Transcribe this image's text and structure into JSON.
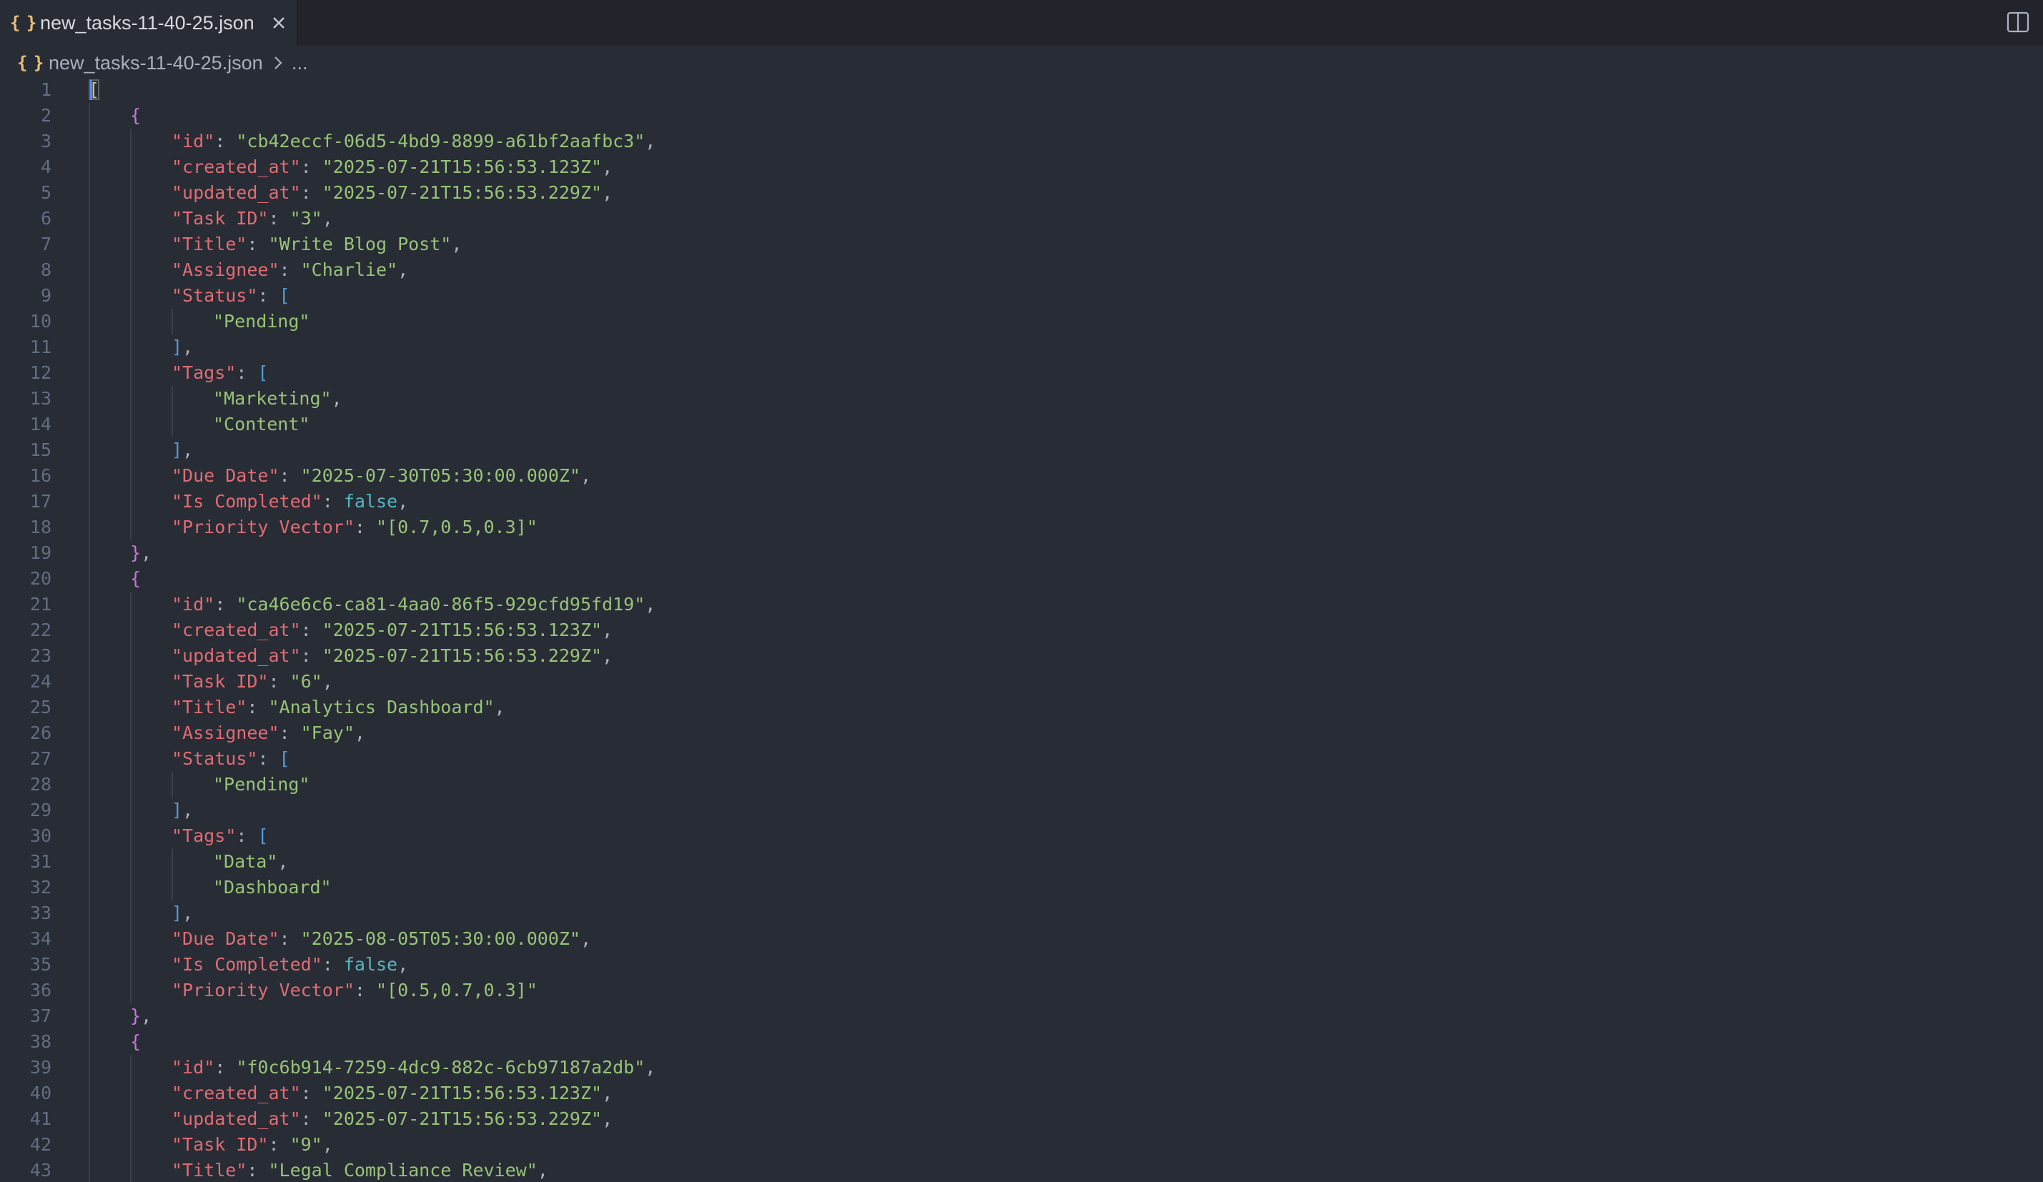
{
  "tab": {
    "label": "new_tasks-11-40-25.json",
    "icon": "json-file-icon",
    "icon_glyph": "{ }"
  },
  "breadcrumb": {
    "file": "new_tasks-11-40-25.json",
    "more": "..."
  },
  "colors": {
    "background": "#282c34",
    "tabbar": "#21252b",
    "key": "#e06c75",
    "string": "#98c379",
    "boolean": "#56b6c2",
    "bracket_array": "#569cd6",
    "bracket_object": "#c678dd",
    "root_bracket": "#e5c07b",
    "line_number": "#636d83"
  },
  "lines": [
    {
      "n": "1",
      "indent": 0,
      "parts": [
        [
          "[",
          "root"
        ]
      ]
    },
    {
      "n": "2",
      "indent": 1,
      "parts": [
        [
          "{",
          "obj"
        ]
      ]
    },
    {
      "n": "3",
      "indent": 2,
      "parts": [
        [
          "\"id\"",
          "k"
        ],
        [
          ": ",
          "p"
        ],
        [
          "\"cb42eccf-06d5-4bd9-8899-a61bf2aafbc3\"",
          "s"
        ],
        [
          ",",
          "p"
        ]
      ]
    },
    {
      "n": "4",
      "indent": 2,
      "parts": [
        [
          "\"created_at\"",
          "k"
        ],
        [
          ": ",
          "p"
        ],
        [
          "\"2025-07-21T15:56:53.123Z\"",
          "s"
        ],
        [
          ",",
          "p"
        ]
      ]
    },
    {
      "n": "5",
      "indent": 2,
      "parts": [
        [
          "\"updated_at\"",
          "k"
        ],
        [
          ": ",
          "p"
        ],
        [
          "\"2025-07-21T15:56:53.229Z\"",
          "s"
        ],
        [
          ",",
          "p"
        ]
      ]
    },
    {
      "n": "6",
      "indent": 2,
      "parts": [
        [
          "\"Task ID\"",
          "k"
        ],
        [
          ": ",
          "p"
        ],
        [
          "\"3\"",
          "s"
        ],
        [
          ",",
          "p"
        ]
      ]
    },
    {
      "n": "7",
      "indent": 2,
      "parts": [
        [
          "\"Title\"",
          "k"
        ],
        [
          ": ",
          "p"
        ],
        [
          "\"Write Blog Post\"",
          "s"
        ],
        [
          ",",
          "p"
        ]
      ]
    },
    {
      "n": "8",
      "indent": 2,
      "parts": [
        [
          "\"Assignee\"",
          "k"
        ],
        [
          ": ",
          "p"
        ],
        [
          "\"Charlie\"",
          "s"
        ],
        [
          ",",
          "p"
        ]
      ]
    },
    {
      "n": "9",
      "indent": 2,
      "parts": [
        [
          "\"Status\"",
          "k"
        ],
        [
          ": ",
          "p"
        ],
        [
          "[",
          "b"
        ]
      ]
    },
    {
      "n": "10",
      "indent": 3,
      "parts": [
        [
          "\"Pending\"",
          "s"
        ]
      ]
    },
    {
      "n": "11",
      "indent": 2,
      "parts": [
        [
          "]",
          "b"
        ],
        [
          ",",
          "p"
        ]
      ]
    },
    {
      "n": "12",
      "indent": 2,
      "parts": [
        [
          "\"Tags\"",
          "k"
        ],
        [
          ": ",
          "p"
        ],
        [
          "[",
          "b"
        ]
      ]
    },
    {
      "n": "13",
      "indent": 3,
      "parts": [
        [
          "\"Marketing\"",
          "s"
        ],
        [
          ",",
          "p"
        ]
      ]
    },
    {
      "n": "14",
      "indent": 3,
      "parts": [
        [
          "\"Content\"",
          "s"
        ]
      ]
    },
    {
      "n": "15",
      "indent": 2,
      "parts": [
        [
          "]",
          "b"
        ],
        [
          ",",
          "p"
        ]
      ]
    },
    {
      "n": "16",
      "indent": 2,
      "parts": [
        [
          "\"Due Date\"",
          "k"
        ],
        [
          ": ",
          "p"
        ],
        [
          "\"2025-07-30T05:30:00.000Z\"",
          "s"
        ],
        [
          ",",
          "p"
        ]
      ]
    },
    {
      "n": "17",
      "indent": 2,
      "parts": [
        [
          "\"Is Completed\"",
          "k"
        ],
        [
          ": ",
          "p"
        ],
        [
          "false",
          "bool"
        ],
        [
          ",",
          "p"
        ]
      ]
    },
    {
      "n": "18",
      "indent": 2,
      "parts": [
        [
          "\"Priority Vector\"",
          "k"
        ],
        [
          ": ",
          "p"
        ],
        [
          "\"[0.7,0.5,0.3]\"",
          "s"
        ]
      ]
    },
    {
      "n": "19",
      "indent": 1,
      "parts": [
        [
          "}",
          "obj"
        ],
        [
          ",",
          "p"
        ]
      ]
    },
    {
      "n": "20",
      "indent": 1,
      "parts": [
        [
          "{",
          "obj"
        ]
      ]
    },
    {
      "n": "21",
      "indent": 2,
      "parts": [
        [
          "\"id\"",
          "k"
        ],
        [
          ": ",
          "p"
        ],
        [
          "\"ca46e6c6-ca81-4aa0-86f5-929cfd95fd19\"",
          "s"
        ],
        [
          ",",
          "p"
        ]
      ]
    },
    {
      "n": "22",
      "indent": 2,
      "parts": [
        [
          "\"created_at\"",
          "k"
        ],
        [
          ": ",
          "p"
        ],
        [
          "\"2025-07-21T15:56:53.123Z\"",
          "s"
        ],
        [
          ",",
          "p"
        ]
      ]
    },
    {
      "n": "23",
      "indent": 2,
      "parts": [
        [
          "\"updated_at\"",
          "k"
        ],
        [
          ": ",
          "p"
        ],
        [
          "\"2025-07-21T15:56:53.229Z\"",
          "s"
        ],
        [
          ",",
          "p"
        ]
      ]
    },
    {
      "n": "24",
      "indent": 2,
      "parts": [
        [
          "\"Task ID\"",
          "k"
        ],
        [
          ": ",
          "p"
        ],
        [
          "\"6\"",
          "s"
        ],
        [
          ",",
          "p"
        ]
      ]
    },
    {
      "n": "25",
      "indent": 2,
      "parts": [
        [
          "\"Title\"",
          "k"
        ],
        [
          ": ",
          "p"
        ],
        [
          "\"Analytics Dashboard\"",
          "s"
        ],
        [
          ",",
          "p"
        ]
      ]
    },
    {
      "n": "26",
      "indent": 2,
      "parts": [
        [
          "\"Assignee\"",
          "k"
        ],
        [
          ": ",
          "p"
        ],
        [
          "\"Fay\"",
          "s"
        ],
        [
          ",",
          "p"
        ]
      ]
    },
    {
      "n": "27",
      "indent": 2,
      "parts": [
        [
          "\"Status\"",
          "k"
        ],
        [
          ": ",
          "p"
        ],
        [
          "[",
          "b"
        ]
      ]
    },
    {
      "n": "28",
      "indent": 3,
      "parts": [
        [
          "\"Pending\"",
          "s"
        ]
      ]
    },
    {
      "n": "29",
      "indent": 2,
      "parts": [
        [
          "]",
          "b"
        ],
        [
          ",",
          "p"
        ]
      ]
    },
    {
      "n": "30",
      "indent": 2,
      "parts": [
        [
          "\"Tags\"",
          "k"
        ],
        [
          ": ",
          "p"
        ],
        [
          "[",
          "b"
        ]
      ]
    },
    {
      "n": "31",
      "indent": 3,
      "parts": [
        [
          "\"Data\"",
          "s"
        ],
        [
          ",",
          "p"
        ]
      ]
    },
    {
      "n": "32",
      "indent": 3,
      "parts": [
        [
          "\"Dashboard\"",
          "s"
        ]
      ]
    },
    {
      "n": "33",
      "indent": 2,
      "parts": [
        [
          "]",
          "b"
        ],
        [
          ",",
          "p"
        ]
      ]
    },
    {
      "n": "34",
      "indent": 2,
      "parts": [
        [
          "\"Due Date\"",
          "k"
        ],
        [
          ": ",
          "p"
        ],
        [
          "\"2025-08-05T05:30:00.000Z\"",
          "s"
        ],
        [
          ",",
          "p"
        ]
      ]
    },
    {
      "n": "35",
      "indent": 2,
      "parts": [
        [
          "\"Is Completed\"",
          "k"
        ],
        [
          ": ",
          "p"
        ],
        [
          "false",
          "bool"
        ],
        [
          ",",
          "p"
        ]
      ]
    },
    {
      "n": "36",
      "indent": 2,
      "parts": [
        [
          "\"Priority Vector\"",
          "k"
        ],
        [
          ": ",
          "p"
        ],
        [
          "\"[0.5,0.7,0.3]\"",
          "s"
        ]
      ]
    },
    {
      "n": "37",
      "indent": 1,
      "parts": [
        [
          "}",
          "obj"
        ],
        [
          ",",
          "p"
        ]
      ]
    },
    {
      "n": "38",
      "indent": 1,
      "parts": [
        [
          "{",
          "obj"
        ]
      ]
    },
    {
      "n": "39",
      "indent": 2,
      "parts": [
        [
          "\"id\"",
          "k"
        ],
        [
          ": ",
          "p"
        ],
        [
          "\"f0c6b914-7259-4dc9-882c-6cb97187a2db\"",
          "s"
        ],
        [
          ",",
          "p"
        ]
      ]
    },
    {
      "n": "40",
      "indent": 2,
      "parts": [
        [
          "\"created_at\"",
          "k"
        ],
        [
          ": ",
          "p"
        ],
        [
          "\"2025-07-21T15:56:53.123Z\"",
          "s"
        ],
        [
          ",",
          "p"
        ]
      ]
    },
    {
      "n": "41",
      "indent": 2,
      "parts": [
        [
          "\"updated_at\"",
          "k"
        ],
        [
          ": ",
          "p"
        ],
        [
          "\"2025-07-21T15:56:53.229Z\"",
          "s"
        ],
        [
          ",",
          "p"
        ]
      ]
    },
    {
      "n": "42",
      "indent": 2,
      "parts": [
        [
          "\"Task ID\"",
          "k"
        ],
        [
          ": ",
          "p"
        ],
        [
          "\"9\"",
          "s"
        ],
        [
          ",",
          "p"
        ]
      ]
    },
    {
      "n": "43",
      "indent": 2,
      "parts": [
        [
          "\"Title\"",
          "k"
        ],
        [
          ": ",
          "p"
        ],
        [
          "\"Legal Compliance Review\"",
          "s"
        ],
        [
          ",",
          "p"
        ]
      ]
    }
  ]
}
